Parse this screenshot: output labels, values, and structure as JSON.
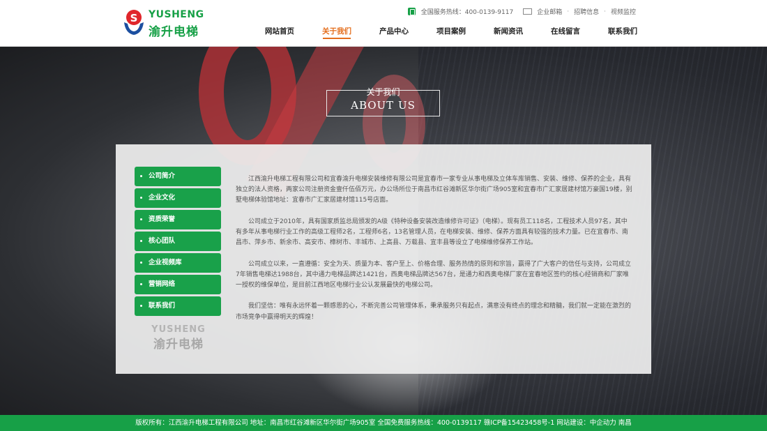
{
  "header": {
    "logo_en": "YUSHENG",
    "logo_cn": "渝升电梯",
    "hotline_label": "全国服务热线：400-0139-9117",
    "top_links": [
      "企业邮箱",
      "招聘信息",
      "视频监控"
    ],
    "nav": [
      "网站首页",
      "关于我们",
      "产品中心",
      "项目案例",
      "新闻资讯",
      "在线留言",
      "联系我们"
    ],
    "active_nav": "关于我们"
  },
  "banner": {
    "title_cn": "关于我们",
    "title_en": "ABOUT US"
  },
  "sidebar": {
    "items": [
      "公司简介",
      "企业文化",
      "资质荣誉",
      "核心团队",
      "企业视频库",
      "营销网络",
      "联系我们"
    ],
    "logo_en": "YUSHENG",
    "logo_cn": "渝升电梯"
  },
  "article": {
    "paragraphs": [
      "江西渝升电梯工程有限公司和宜春渝升电梯安装维修有限公司是宜春市一家专业从事电梯及立体车库销售、安装、维修、保养的企业，具有独立的法人资格，两家公司注册资金壹仟伍佰万元，办公场所位于南昌市红谷滩新区华尔街广场905室和宜春市广汇家居建材馆万豪国19楼，别墅电梯体验馆地址：宜春市广汇家居建材馆115号店面。",
      "公司成立于2010年，具有国家质监总局颁发的A级《特种设备安装改造维修许可证》（电梯）。现有员工118名，工程技术人员97名，其中有多年从事电梯行业工作的高级工程师2名，工程师6名，13名管理人员，在电梯安装、维修、保养方面具有较强的技术力量。已在宜春市、南昌市、萍乡市、新余市、高安市、樟树市、丰城市、上高县、万载县、宜丰县等设立了电梯维修保养工作站。",
      "公司成立以来，一直遵循：安全为天、质量为本、客户至上、价格合理、服务热情的原则和宗旨，赢得了广大客户的信任与支持，公司成立7年销售电梯达1988台，其中通力电梯品牌达1421台，西奥电梯品牌达567台，是通力和西奥电梯厂家在宜春地区签约的核心经销商和厂家唯一授权的维保单位，是目前江西地区电梯行业公认发展最快的电梯公司。",
      "我们坚信：唯有永远怀着一颗感恩的心，不断完善公司管理体系，秉承服务只有起点，满意没有终点的理念和精髓，我们就一定能在激烈的市场竞争中赢得明天的辉煌！"
    ]
  },
  "footer": {
    "text": "版权所有：江西渝升电梯工程有限公司  地址：南昌市红谷滩新区华尔街广场905室  全国免费服务热线：400-0139117  赣ICP备15423458号-1  网站建设：中企动力 南昌"
  },
  "colors": {
    "brand_green": "#17a047",
    "accent_orange": "#e46d1b",
    "logo_red": "#e0262b",
    "logo_blue": "#1c4fa0"
  }
}
